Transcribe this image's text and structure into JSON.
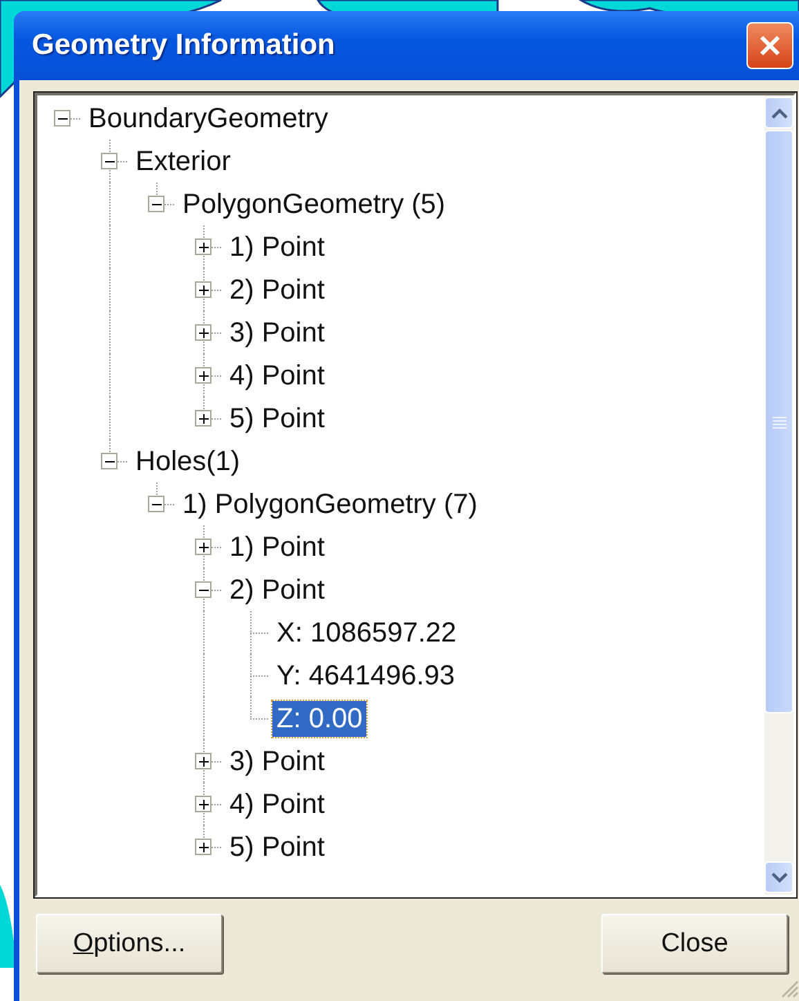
{
  "window": {
    "title": "Geometry Information"
  },
  "tree": [
    {
      "label": "BoundaryGeometry",
      "kind": "group",
      "expanded": true,
      "selected": false,
      "children": [
        {
          "label": "Exterior",
          "kind": "group",
          "expanded": true,
          "selected": false,
          "children": [
            {
              "label": "PolygonGeometry (5)",
              "kind": "group",
              "expanded": true,
              "selected": false,
              "children": [
                {
                  "label": "1) Point",
                  "kind": "group",
                  "expanded": false,
                  "selected": false
                },
                {
                  "label": "2) Point",
                  "kind": "group",
                  "expanded": false,
                  "selected": false
                },
                {
                  "label": "3) Point",
                  "kind": "group",
                  "expanded": false,
                  "selected": false
                },
                {
                  "label": "4) Point",
                  "kind": "group",
                  "expanded": false,
                  "selected": false
                },
                {
                  "label": "5) Point",
                  "kind": "group",
                  "expanded": false,
                  "selected": false
                }
              ]
            }
          ]
        },
        {
          "label": "Holes(1)",
          "kind": "group",
          "expanded": true,
          "selected": false,
          "children": [
            {
              "label": "1) PolygonGeometry (7)",
              "kind": "group",
              "expanded": true,
              "selected": false,
              "children": [
                {
                  "label": "1) Point",
                  "kind": "group",
                  "expanded": false,
                  "selected": false
                },
                {
                  "label": "2) Point",
                  "kind": "group",
                  "expanded": true,
                  "selected": false,
                  "children": [
                    {
                      "label": "X: 1086597.22",
                      "kind": "value",
                      "selected": false
                    },
                    {
                      "label": "Y: 4641496.93",
                      "kind": "value",
                      "selected": false
                    },
                    {
                      "label": "Z: 0.00",
                      "kind": "value",
                      "selected": true
                    }
                  ]
                },
                {
                  "label": "3) Point",
                  "kind": "group",
                  "expanded": false,
                  "selected": false
                },
                {
                  "label": "4) Point",
                  "kind": "group",
                  "expanded": false,
                  "selected": false
                },
                {
                  "label": "5) Point",
                  "kind": "group",
                  "expanded": false,
                  "selected": false
                }
              ]
            }
          ]
        }
      ]
    }
  ],
  "buttons": [
    {
      "mnemonic": "O",
      "label_rest": "ptions..."
    },
    {
      "label": "Close"
    }
  ]
}
